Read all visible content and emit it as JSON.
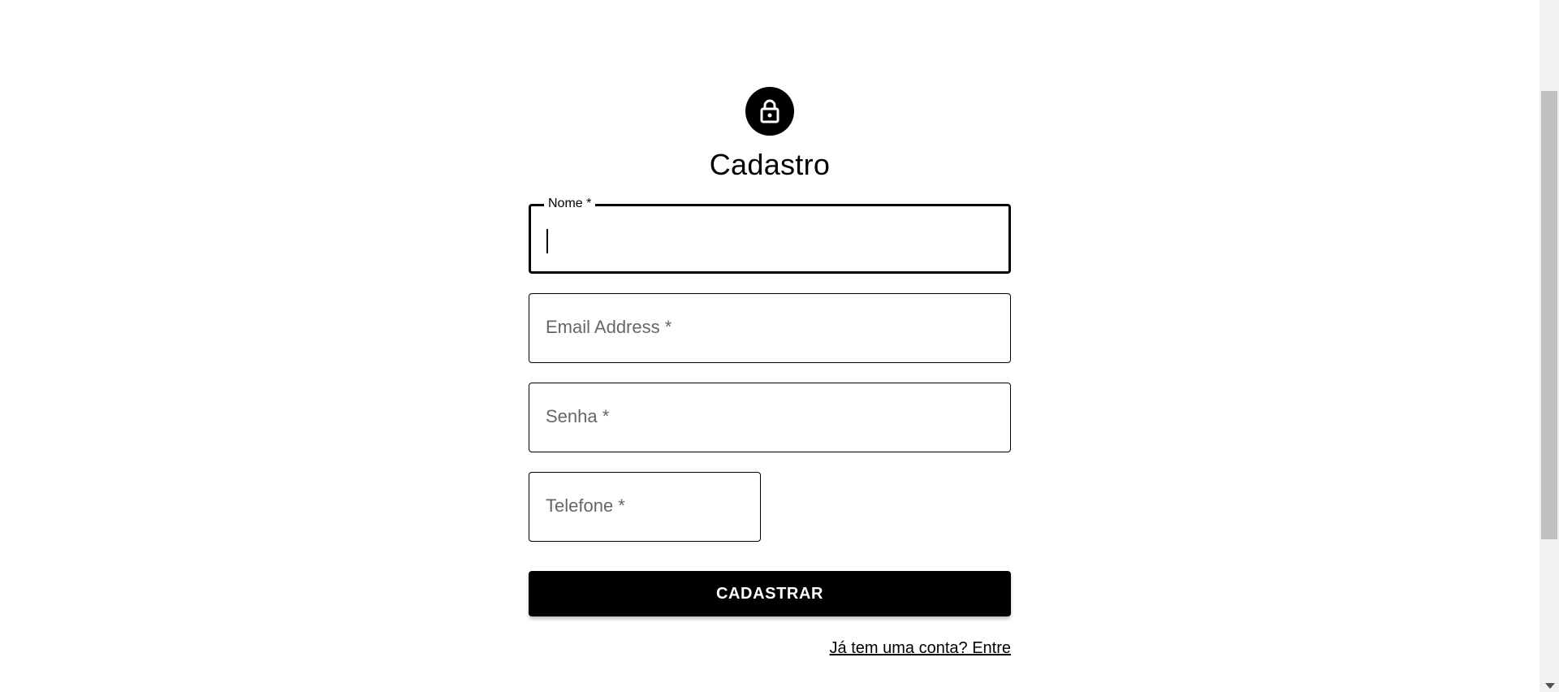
{
  "page": {
    "title": "Cadastro"
  },
  "avatar": {
    "icon": "lock-icon"
  },
  "form": {
    "fields": [
      {
        "label": "Nome *",
        "value": ""
      },
      {
        "label": "Email Address *",
        "value": ""
      },
      {
        "label": "Senha *",
        "value": ""
      },
      {
        "label": "Telefone *",
        "value": ""
      }
    ],
    "submit_label": "CADASTRAR",
    "login_link": "Já tem uma conta? Entre"
  },
  "colors": {
    "primary": "#000000",
    "background": "#ffffff",
    "placeholder": "#666666"
  }
}
